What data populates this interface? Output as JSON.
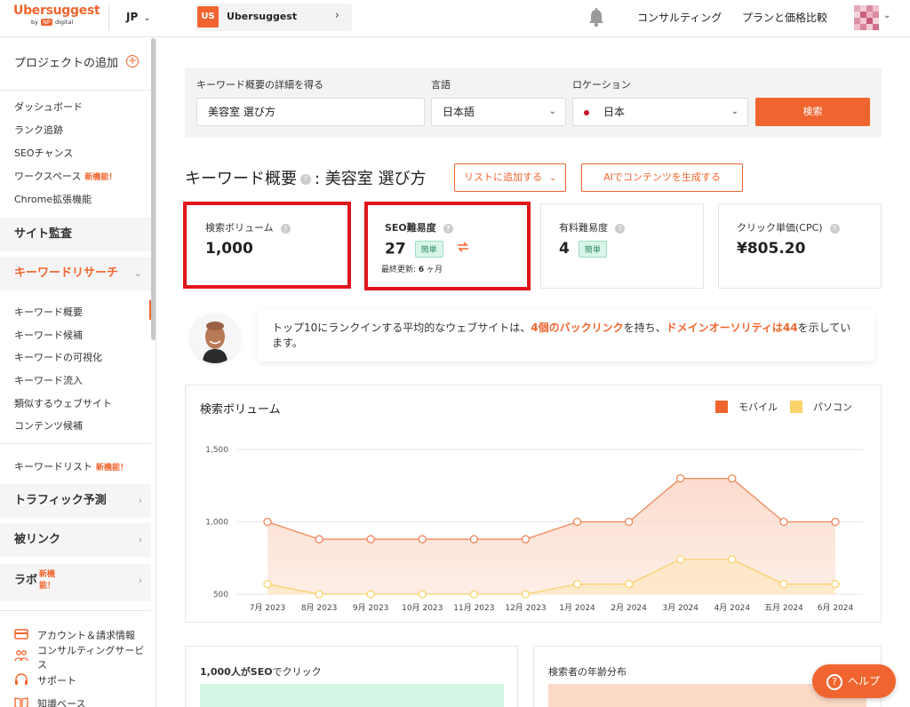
{
  "header": {
    "logo_text": "Ubersuggest",
    "logo_by": "by",
    "logo_np": "NP",
    "logo_digital": "digital",
    "language": "JP",
    "project_avatar": "US",
    "project_name": "Ubersuggest",
    "consulting": "コンサルティング",
    "plans": "プランと価格比較"
  },
  "sidebar": {
    "add_project": "プロジェクトの追加",
    "items_top": [
      "ダッシュボード",
      "ランク追跡",
      "SEOチャンス"
    ],
    "workspace": "ワークスペース",
    "workspace_new": "新機能！",
    "chrome": "Chrome拡張機能",
    "site_audit": "サイト監査",
    "keyword_research": "キーワードリサーチ",
    "kw_items": [
      "キーワード概要",
      "キーワード候補",
      "キーワードの可視化",
      "キーワード流入",
      "類似するウェブサイト",
      "コンテンツ候補"
    ],
    "keyword_list": "キーワードリスト",
    "keyword_list_new": "新機能！",
    "traffic": "トラフィック予測",
    "backlinks": "被リンク",
    "labs": "ラボ",
    "labs_new_1": "新機",
    "labs_new_2": "能！",
    "account": "アカウント＆請求情報",
    "consulting_1": "コンサルティングサービ",
    "consulting_2": "ス",
    "support": "サポート",
    "knowledge": "知識ベース"
  },
  "search": {
    "keyword_label": "キーワード概要の詳細を得る",
    "keyword_value": "美容室 選び方",
    "language_label": "言語",
    "language_value": "日本語",
    "location_label": "ロケーション",
    "location_value": "日本",
    "button": "検索"
  },
  "overview": {
    "title_prefix": "キーワード概要",
    "title_keyword": ": 美容室 選び方",
    "add_to_list": "リストに追加する",
    "ai_button": "AIでコンテンツを生成する"
  },
  "metrics": {
    "volume_label": "検索ボリューム",
    "volume_value": "1,000",
    "seo_label": "SEO難易度",
    "seo_value": "27",
    "seo_badge": "簡単",
    "seo_updated_prefix": "最終更新: ",
    "seo_updated_value": "6",
    "seo_updated_suffix": " ヶ月",
    "paid_label": "有料難易度",
    "paid_value": "4",
    "paid_badge": "簡単",
    "cpc_label": "クリック単価(CPC)",
    "cpc_value": "¥805.20"
  },
  "tip": {
    "part1": "トップ10にランクインする平均的なウェブサイトは、",
    "link1": "4個のバックリンク",
    "part2": "を持ち、",
    "link2": "ドメインオーソリティは44",
    "part3": "を示しています。"
  },
  "chart_data": {
    "type": "area",
    "title": "検索ボリューム",
    "categories": [
      "7月 2023",
      "8月 2023",
      "9月 2023",
      "10月 2023",
      "11月 2023",
      "12月 2023",
      "1月 2024",
      "2月 2024",
      "3月 2024",
      "4月 2024",
      "五月 2024",
      "6月 2024"
    ],
    "series": [
      {
        "name": "モバイル",
        "color": "#f0652f",
        "values": [
          1000,
          880,
          880,
          880,
          880,
          880,
          1000,
          1000,
          1300,
          1300,
          1000,
          1000
        ]
      },
      {
        "name": "パソコン",
        "color": "#fbd26a",
        "values": [
          570,
          500,
          500,
          500,
          500,
          500,
          570,
          570,
          740,
          740,
          570,
          570
        ]
      }
    ],
    "ylim": [
      500,
      1500
    ],
    "yticks": [
      "500",
      "1,000",
      "1,500"
    ],
    "legend": "top-right",
    "grid": true
  },
  "bottom": {
    "left_title_bold": "1,000人がSEO",
    "left_title_rest": "でクリック",
    "right_title": "検索者の年齢分布"
  },
  "help": {
    "label": "ヘルプ",
    "icon": "?"
  },
  "colors": {
    "accent": "#f0652f",
    "desktop": "#fbd26a",
    "highlight": "#e0151c",
    "easy_badge": "#d9f5ea"
  }
}
